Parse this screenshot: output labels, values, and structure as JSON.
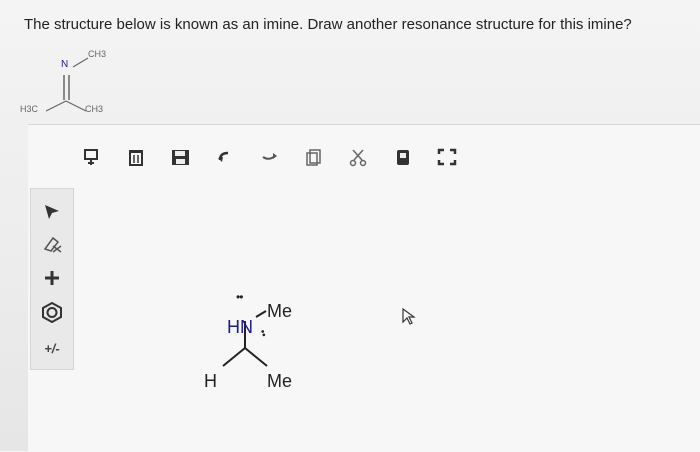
{
  "question": "The structure below is known as an imine. Draw another resonance structure for this imine?",
  "imine": {
    "atom_n": "N",
    "group_top": "CH3",
    "group_left": "H3C",
    "group_right": "CH3"
  },
  "toolbar": [
    {
      "name": "template-icon"
    },
    {
      "name": "trash-icon"
    },
    {
      "name": "save-icon"
    },
    {
      "name": "undo-icon"
    },
    {
      "name": "redo-icon"
    },
    {
      "name": "copy-icon"
    },
    {
      "name": "cut-icon"
    },
    {
      "name": "clear-icon"
    },
    {
      "name": "fullscreen-icon"
    }
  ],
  "sidebar": [
    {
      "name": "select-arrow-icon"
    },
    {
      "name": "eraser-icon"
    },
    {
      "name": "add-atom-icon"
    },
    {
      "name": "ring-template-icon"
    },
    {
      "name": "charge-icon",
      "label": "+/-"
    }
  ],
  "drawing": {
    "hn": "HN",
    "me_top": "Me",
    "h": "H",
    "me_bottom": "Me",
    "lone_pair": "••"
  },
  "colors": {
    "text": "#222222",
    "nitrogen": "#1d1d8a",
    "icon": "#333333"
  }
}
